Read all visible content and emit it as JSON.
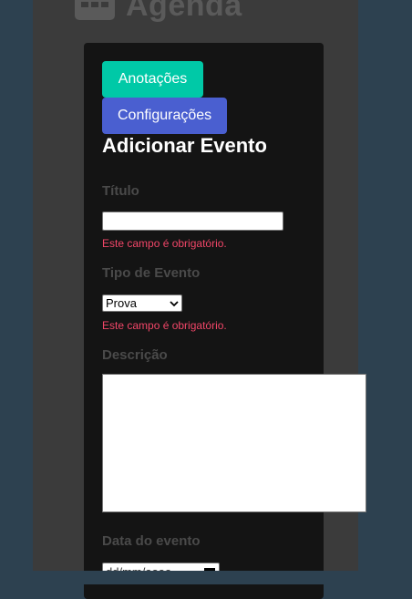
{
  "header": {
    "title": "Agenda",
    "icon": "calendar-grid-icon"
  },
  "buttons": {
    "notes": "Anotações",
    "settings": "Configurações"
  },
  "form": {
    "heading": "Adicionar Evento",
    "title_label": "Título",
    "title_error": "Este campo é obrigatório.",
    "type_label": "Tipo de Evento",
    "type_value": "Prova",
    "type_error": "Este campo é obrigatório.",
    "description_label": "Descrição",
    "date_label": "Data do evento",
    "date_placeholder": "dd/mm/aaaa"
  },
  "colors": {
    "background": "#2d4150",
    "page": "#3b3b3b",
    "card": "#141414",
    "notes_button": "#00c9a7",
    "settings_button": "#4a5fd0",
    "error": "#f14668"
  }
}
